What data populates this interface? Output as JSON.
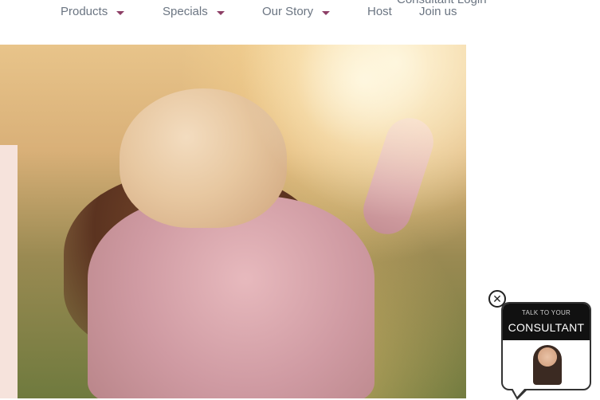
{
  "nav": {
    "items": [
      {
        "label": "Products",
        "has_dropdown": true
      },
      {
        "label": "Specials",
        "has_dropdown": true
      },
      {
        "label": "Our Story",
        "has_dropdown": true
      },
      {
        "label": "Host",
        "has_dropdown": false
      },
      {
        "label": "Join us",
        "has_dropdown": false
      }
    ],
    "consultant_login": "Consultant Login",
    "caret_icon": "caret-down-icon",
    "text_color": "#6b7582",
    "caret_color": "#8d3f66"
  },
  "hero": {
    "image_subject": "child in knit beanie and pink jacket in a field at sunset"
  },
  "widget": {
    "talk_label": "TALK TO YOUR",
    "consultant_label": "CONSULTANT",
    "close_icon": "close-icon",
    "avatar_icon": "consultant-avatar"
  }
}
